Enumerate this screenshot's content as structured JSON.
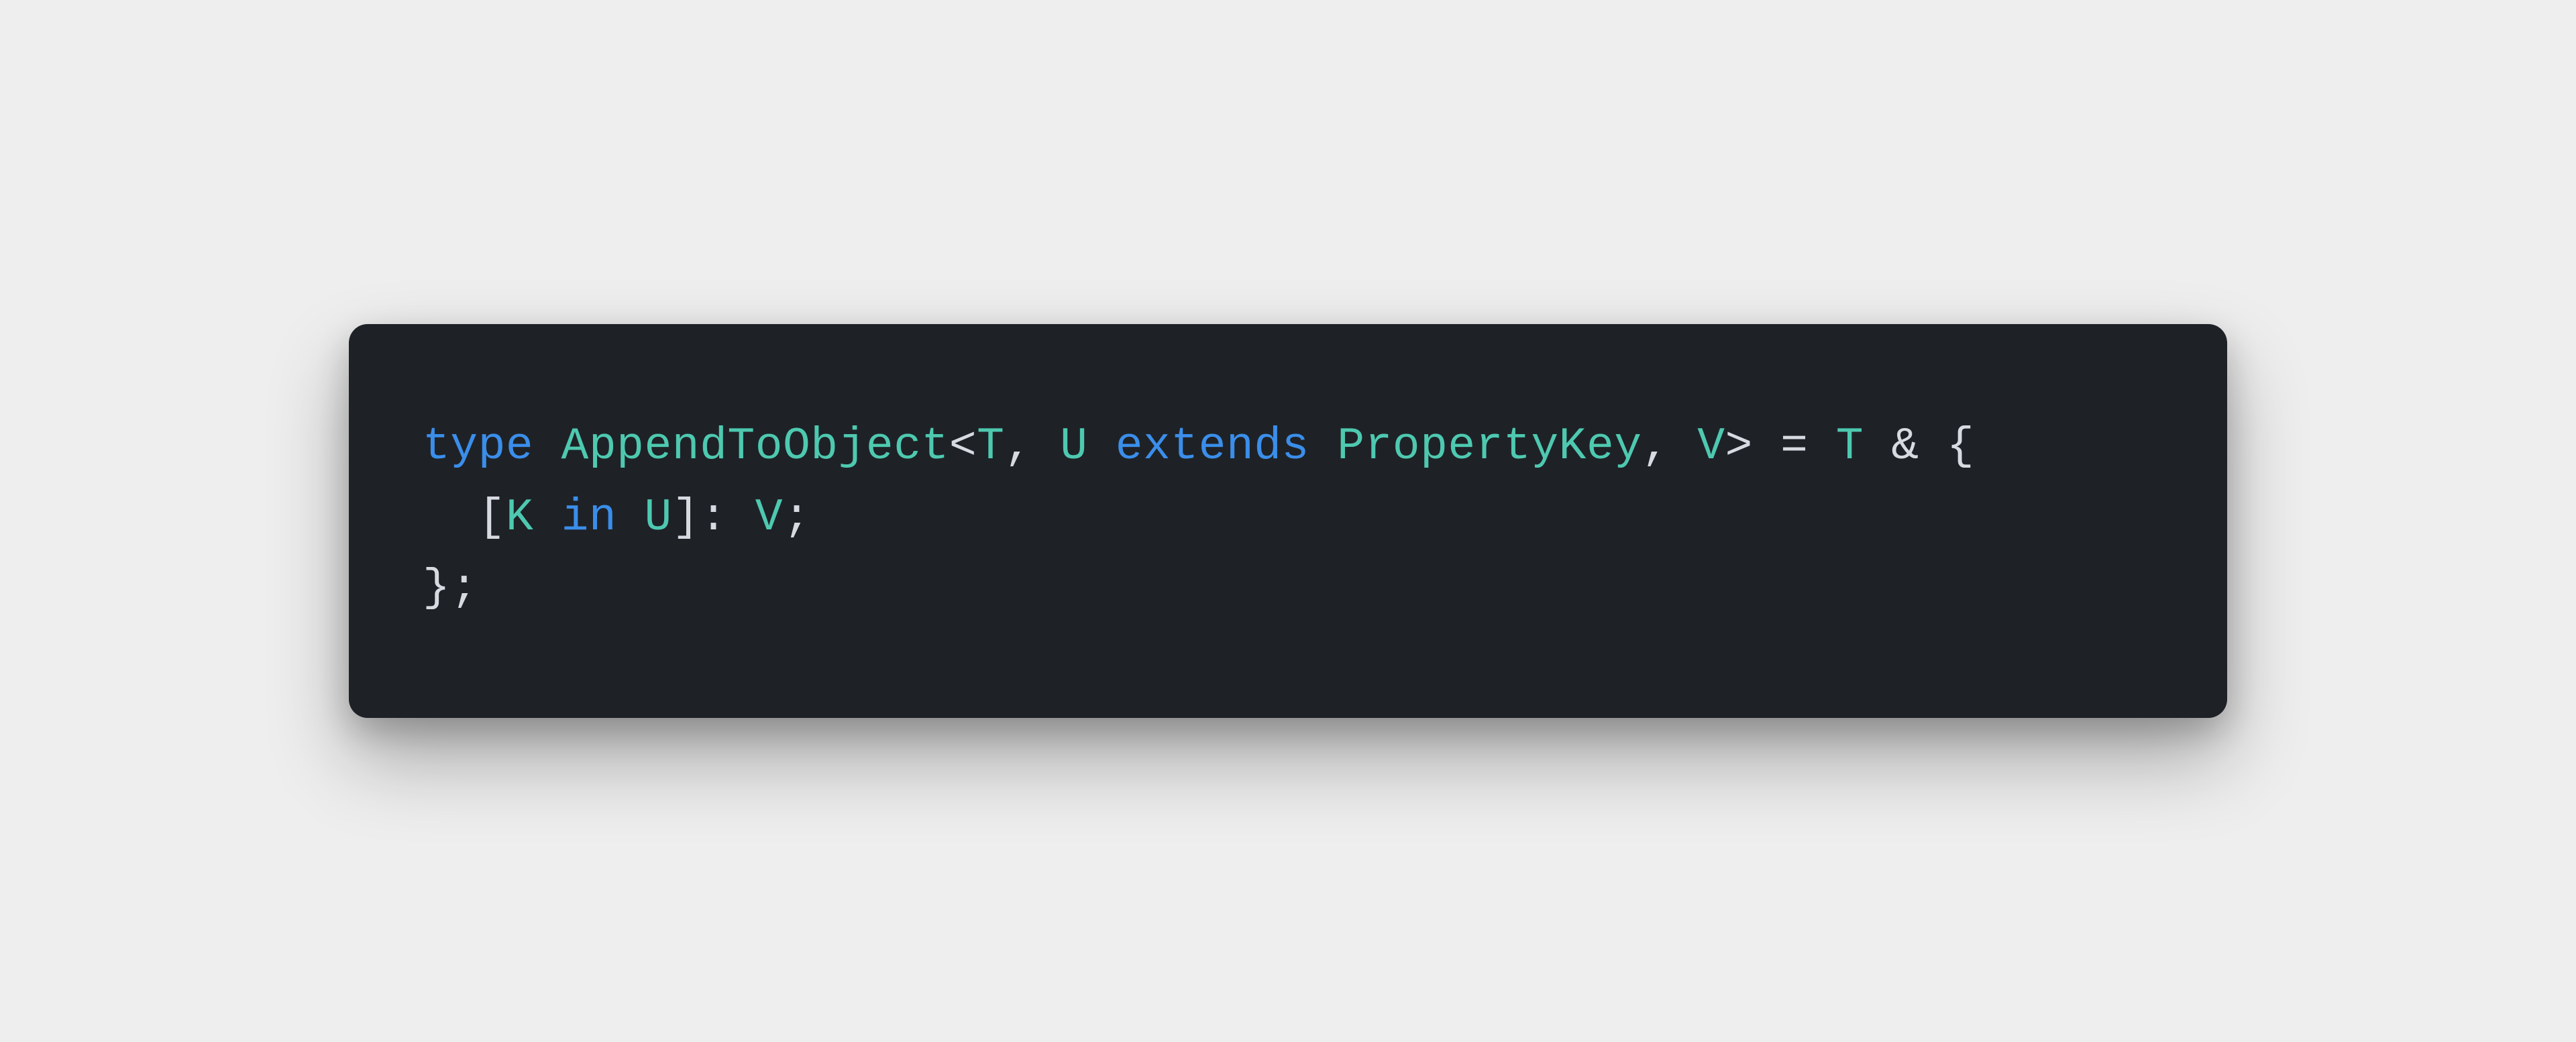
{
  "colors": {
    "background": "#eeeeee",
    "card_bg": "#1e2227",
    "keyword": "#3b8eea",
    "typename": "#4ec9b0",
    "default": "#d7dae0"
  },
  "code": {
    "line1": {
      "kw_type": "type",
      "sp1": " ",
      "name": "AppendToObject",
      "lt": "<",
      "T": "T",
      "comma1": ",",
      "sp2": " ",
      "U": "U",
      "sp3": " ",
      "extends": "extends",
      "sp4": " ",
      "PropertyKey": "PropertyKey",
      "comma2": ",",
      "sp5": " ",
      "V": "V",
      "gt": ">",
      "sp6": " ",
      "eq": "=",
      "sp7": " ",
      "T2": "T",
      "sp8": " ",
      "amp": "&",
      "sp9": " ",
      "lbrace": "{"
    },
    "line2": {
      "indent": "  ",
      "lbracket": "[",
      "K": "K",
      "sp1": " ",
      "in": "in",
      "sp2": " ",
      "U": "U",
      "rbracket": "]",
      "colon": ":",
      "sp3": " ",
      "V": "V",
      "semi": ";"
    },
    "line3": {
      "rbrace": "}",
      "semi": ";"
    }
  }
}
